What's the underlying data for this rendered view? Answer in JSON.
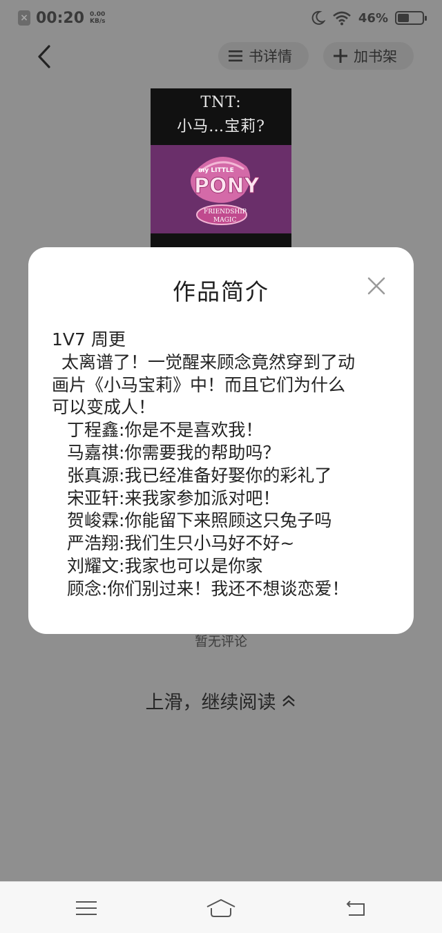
{
  "status_bar": {
    "time": "00:20",
    "speed_value": "0.00",
    "speed_unit": "KB/s",
    "battery_percent": "46%",
    "battery_level": 0.46
  },
  "top_nav": {
    "detail_label": "书详情",
    "add_shelf_label": "加书架"
  },
  "cover": {
    "line1": "TNT:",
    "line2": "小马…宝莉?",
    "logo_text_small": "my LITTLE",
    "logo_text_big": "PONY",
    "logo_sub1": "FRIENDSHIP",
    "logo_sub2": "MAGIC"
  },
  "page": {
    "no_comments": "暂无评论",
    "swipe_up": "上滑，继续阅读"
  },
  "modal": {
    "title": "作品简介",
    "lines": [
      "1V7   周更",
      "太离谱了！一觉醒来顾念竟然穿到了动",
      "画片《小马宝莉》中！而且它们为什么",
      "可以变成人！",
      "丁程鑫:你是不是喜欢我！",
      "马嘉祺:你需要我的帮助吗？",
      "张真源:我已经准备好娶你的彩礼了",
      "宋亚轩:来我家参加派对吧！",
      "贺峻霖:你能留下来照顾这只兔子吗",
      "严浩翔:我们生只小马好不好~",
      "刘耀文:我家也可以是你家",
      "顾念:你们别过来！我还不想谈恋爱！"
    ]
  },
  "colors": {
    "dim_background": "#8f8f8f",
    "modal_bg": "#ffffff",
    "cover_purple": "#6a2f6a",
    "logo_pink": "#d46aa8"
  },
  "icons": {
    "back": "chevron-left-icon",
    "detail": "list-icon",
    "add": "plus-icon",
    "close": "close-icon",
    "swipe": "double-chevron-up-icon",
    "menu": "menu-icon",
    "home": "home-icon",
    "back_nav": "return-icon"
  }
}
